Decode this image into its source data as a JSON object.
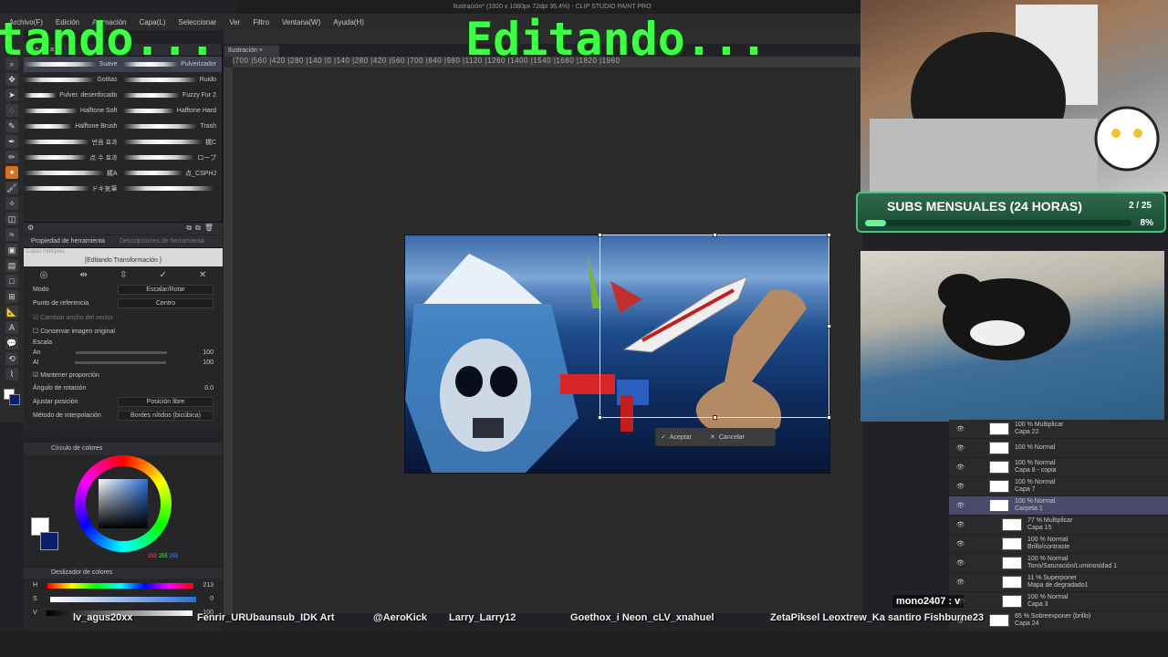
{
  "window": {
    "title": "Ilustración* (1920 x 1080px 72dpi 36.4%) - CLIP STUDIO PAINT PRO",
    "doc_tab": "Ilustración"
  },
  "menu": [
    "Archivo(F)",
    "Edición",
    "Animación",
    "Capa(L)",
    "Seleccionar",
    "Ver",
    "Filtro",
    "Ventana(W)",
    "Ayuda(H)"
  ],
  "overlay": {
    "left_text": "tando...",
    "center_text": "Editando..."
  },
  "ruler": {
    "labels": "|700 |560 |420 |280 |140 |0 |140 |280 |420 |560 |700 |840 |980 |1120 |1260 |1400 |1540 |1680 |1820 |1960"
  },
  "brush_panel": {
    "tab": "Aerógrafo",
    "rows": [
      [
        "Suave",
        "Pulverizador"
      ],
      [
        "Gotitas",
        "Ruido"
      ],
      [
        "Pulver. desenfocado",
        "Fuzzy Fur 2"
      ],
      [
        "Halftone Soft",
        "Halftone Hard"
      ],
      [
        "Halftone Brush",
        "Trash"
      ],
      [
        "반음 효과",
        "梶C"
      ],
      [
        "点 수 효과",
        "ローブ"
      ],
      [
        "梶A",
        "点_CSPHJ"
      ],
      [
        "ドキ気筆",
        ""
      ]
    ]
  },
  "tool_property": {
    "tabs": [
      "Propiedad de herramienta",
      "Descripciones de herramienta"
    ],
    "subtitle": "Capas múltiples",
    "header": "[Editando Transformación ]",
    "modo_label": "Modo",
    "modo_value": "Escalar/Rotar",
    "ref_label": "Punto de referencia",
    "ref_value": "Centro",
    "cambiar": "Cambiar ancho del vector",
    "conservar": "Conservar imagen original",
    "escala": "Escala",
    "an": "An",
    "al": "Al",
    "an_val": "100",
    "al_val": "100",
    "mantener": "Mantener proporción",
    "angulo": "Ángulo de rotación",
    "angulo_val": "0.0",
    "ajustar_label": "Ajustar posición",
    "ajustar_value": "Posición libre",
    "metodo_label": "Método de interpolación",
    "metodo_value": "Bordes nítidos (bicúbica)"
  },
  "color_panel": {
    "tab": "Círculo de colores",
    "r": "255",
    "g": "255",
    "b": "255",
    "main_color": "#ffffff",
    "sub_color": "#0a1e6e"
  },
  "slider_panel": {
    "tab": "Deslizador de colores",
    "H": "H",
    "H_val": "213",
    "S": "S",
    "S_val": "0",
    "V": "V",
    "V_val": "100"
  },
  "transform_bar": {
    "accept": "Aceptar",
    "cancel": "Cancelar"
  },
  "subs": {
    "label": "SUBS MENSUALES (24 HORAS)",
    "count": "2 / 25",
    "percent": "8%",
    "progress": 0.08
  },
  "layers": [
    {
      "mode": "100 % Multiplicar",
      "name": "Capa 22"
    },
    {
      "mode": "100 % Normal",
      "name": ""
    },
    {
      "mode": "100 % Normal",
      "name": "Capa 8 - copia"
    },
    {
      "mode": "100 % Normal",
      "name": "Capa 7"
    },
    {
      "mode": "100 % Normal",
      "name": "Carpeta 1"
    },
    {
      "mode": "77 % Multiplicar",
      "name": "Capa 15"
    },
    {
      "mode": "100 % Normal",
      "name": "Brillo/contraste"
    },
    {
      "mode": "100 % Normal",
      "name": "Tono/Saturación/Luminosidad 1"
    },
    {
      "mode": "11 % Superponer",
      "name": "Mapa de degradado1"
    },
    {
      "mode": "100 % Normal",
      "name": "Capa 3"
    },
    {
      "mode": "65 % Sobreexponer (brillo)",
      "name": "Capa 24"
    },
    {
      "mode": "55 % Multiplicar",
      "name": "Capa 23"
    }
  ],
  "chat_message": "mono2407 : v",
  "chat_names": [
    "lv_agus20xx",
    "Fenrir_URUbaunsub_IDK Art",
    "@AeroKick",
    "Larry_Larry12",
    "Goethox_i Neon_cLV_xnahuel",
    "ZetaPiksel Leoxtrew_Ka santiro Fishburne23"
  ]
}
